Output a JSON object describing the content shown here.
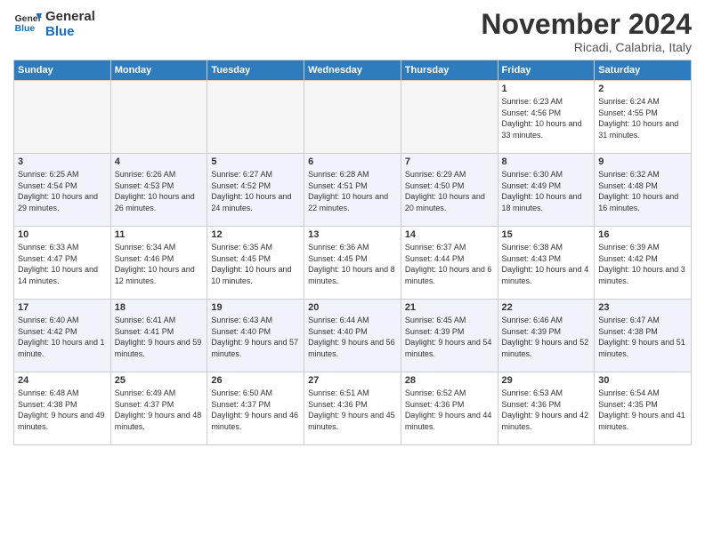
{
  "logo": {
    "text_general": "General",
    "text_blue": "Blue"
  },
  "header": {
    "month": "November 2024",
    "location": "Ricadi, Calabria, Italy"
  },
  "weekdays": [
    "Sunday",
    "Monday",
    "Tuesday",
    "Wednesday",
    "Thursday",
    "Friday",
    "Saturday"
  ],
  "weeks": [
    [
      {
        "day": "",
        "detail": ""
      },
      {
        "day": "",
        "detail": ""
      },
      {
        "day": "",
        "detail": ""
      },
      {
        "day": "",
        "detail": ""
      },
      {
        "day": "",
        "detail": ""
      },
      {
        "day": "1",
        "detail": "Sunrise: 6:23 AM\nSunset: 4:56 PM\nDaylight: 10 hours\nand 33 minutes."
      },
      {
        "day": "2",
        "detail": "Sunrise: 6:24 AM\nSunset: 4:55 PM\nDaylight: 10 hours\nand 31 minutes."
      }
    ],
    [
      {
        "day": "3",
        "detail": "Sunrise: 6:25 AM\nSunset: 4:54 PM\nDaylight: 10 hours\nand 29 minutes."
      },
      {
        "day": "4",
        "detail": "Sunrise: 6:26 AM\nSunset: 4:53 PM\nDaylight: 10 hours\nand 26 minutes."
      },
      {
        "day": "5",
        "detail": "Sunrise: 6:27 AM\nSunset: 4:52 PM\nDaylight: 10 hours\nand 24 minutes."
      },
      {
        "day": "6",
        "detail": "Sunrise: 6:28 AM\nSunset: 4:51 PM\nDaylight: 10 hours\nand 22 minutes."
      },
      {
        "day": "7",
        "detail": "Sunrise: 6:29 AM\nSunset: 4:50 PM\nDaylight: 10 hours\nand 20 minutes."
      },
      {
        "day": "8",
        "detail": "Sunrise: 6:30 AM\nSunset: 4:49 PM\nDaylight: 10 hours\nand 18 minutes."
      },
      {
        "day": "9",
        "detail": "Sunrise: 6:32 AM\nSunset: 4:48 PM\nDaylight: 10 hours\nand 16 minutes."
      }
    ],
    [
      {
        "day": "10",
        "detail": "Sunrise: 6:33 AM\nSunset: 4:47 PM\nDaylight: 10 hours\nand 14 minutes."
      },
      {
        "day": "11",
        "detail": "Sunrise: 6:34 AM\nSunset: 4:46 PM\nDaylight: 10 hours\nand 12 minutes."
      },
      {
        "day": "12",
        "detail": "Sunrise: 6:35 AM\nSunset: 4:45 PM\nDaylight: 10 hours\nand 10 minutes."
      },
      {
        "day": "13",
        "detail": "Sunrise: 6:36 AM\nSunset: 4:45 PM\nDaylight: 10 hours\nand 8 minutes."
      },
      {
        "day": "14",
        "detail": "Sunrise: 6:37 AM\nSunset: 4:44 PM\nDaylight: 10 hours\nand 6 minutes."
      },
      {
        "day": "15",
        "detail": "Sunrise: 6:38 AM\nSunset: 4:43 PM\nDaylight: 10 hours\nand 4 minutes."
      },
      {
        "day": "16",
        "detail": "Sunrise: 6:39 AM\nSunset: 4:42 PM\nDaylight: 10 hours\nand 3 minutes."
      }
    ],
    [
      {
        "day": "17",
        "detail": "Sunrise: 6:40 AM\nSunset: 4:42 PM\nDaylight: 10 hours\nand 1 minute."
      },
      {
        "day": "18",
        "detail": "Sunrise: 6:41 AM\nSunset: 4:41 PM\nDaylight: 9 hours\nand 59 minutes."
      },
      {
        "day": "19",
        "detail": "Sunrise: 6:43 AM\nSunset: 4:40 PM\nDaylight: 9 hours\nand 57 minutes."
      },
      {
        "day": "20",
        "detail": "Sunrise: 6:44 AM\nSunset: 4:40 PM\nDaylight: 9 hours\nand 56 minutes."
      },
      {
        "day": "21",
        "detail": "Sunrise: 6:45 AM\nSunset: 4:39 PM\nDaylight: 9 hours\nand 54 minutes."
      },
      {
        "day": "22",
        "detail": "Sunrise: 6:46 AM\nSunset: 4:39 PM\nDaylight: 9 hours\nand 52 minutes."
      },
      {
        "day": "23",
        "detail": "Sunrise: 6:47 AM\nSunset: 4:38 PM\nDaylight: 9 hours\nand 51 minutes."
      }
    ],
    [
      {
        "day": "24",
        "detail": "Sunrise: 6:48 AM\nSunset: 4:38 PM\nDaylight: 9 hours\nand 49 minutes."
      },
      {
        "day": "25",
        "detail": "Sunrise: 6:49 AM\nSunset: 4:37 PM\nDaylight: 9 hours\nand 48 minutes."
      },
      {
        "day": "26",
        "detail": "Sunrise: 6:50 AM\nSunset: 4:37 PM\nDaylight: 9 hours\nand 46 minutes."
      },
      {
        "day": "27",
        "detail": "Sunrise: 6:51 AM\nSunset: 4:36 PM\nDaylight: 9 hours\nand 45 minutes."
      },
      {
        "day": "28",
        "detail": "Sunrise: 6:52 AM\nSunset: 4:36 PM\nDaylight: 9 hours\nand 44 minutes."
      },
      {
        "day": "29",
        "detail": "Sunrise: 6:53 AM\nSunset: 4:36 PM\nDaylight: 9 hours\nand 42 minutes."
      },
      {
        "day": "30",
        "detail": "Sunrise: 6:54 AM\nSunset: 4:35 PM\nDaylight: 9 hours\nand 41 minutes."
      }
    ]
  ]
}
